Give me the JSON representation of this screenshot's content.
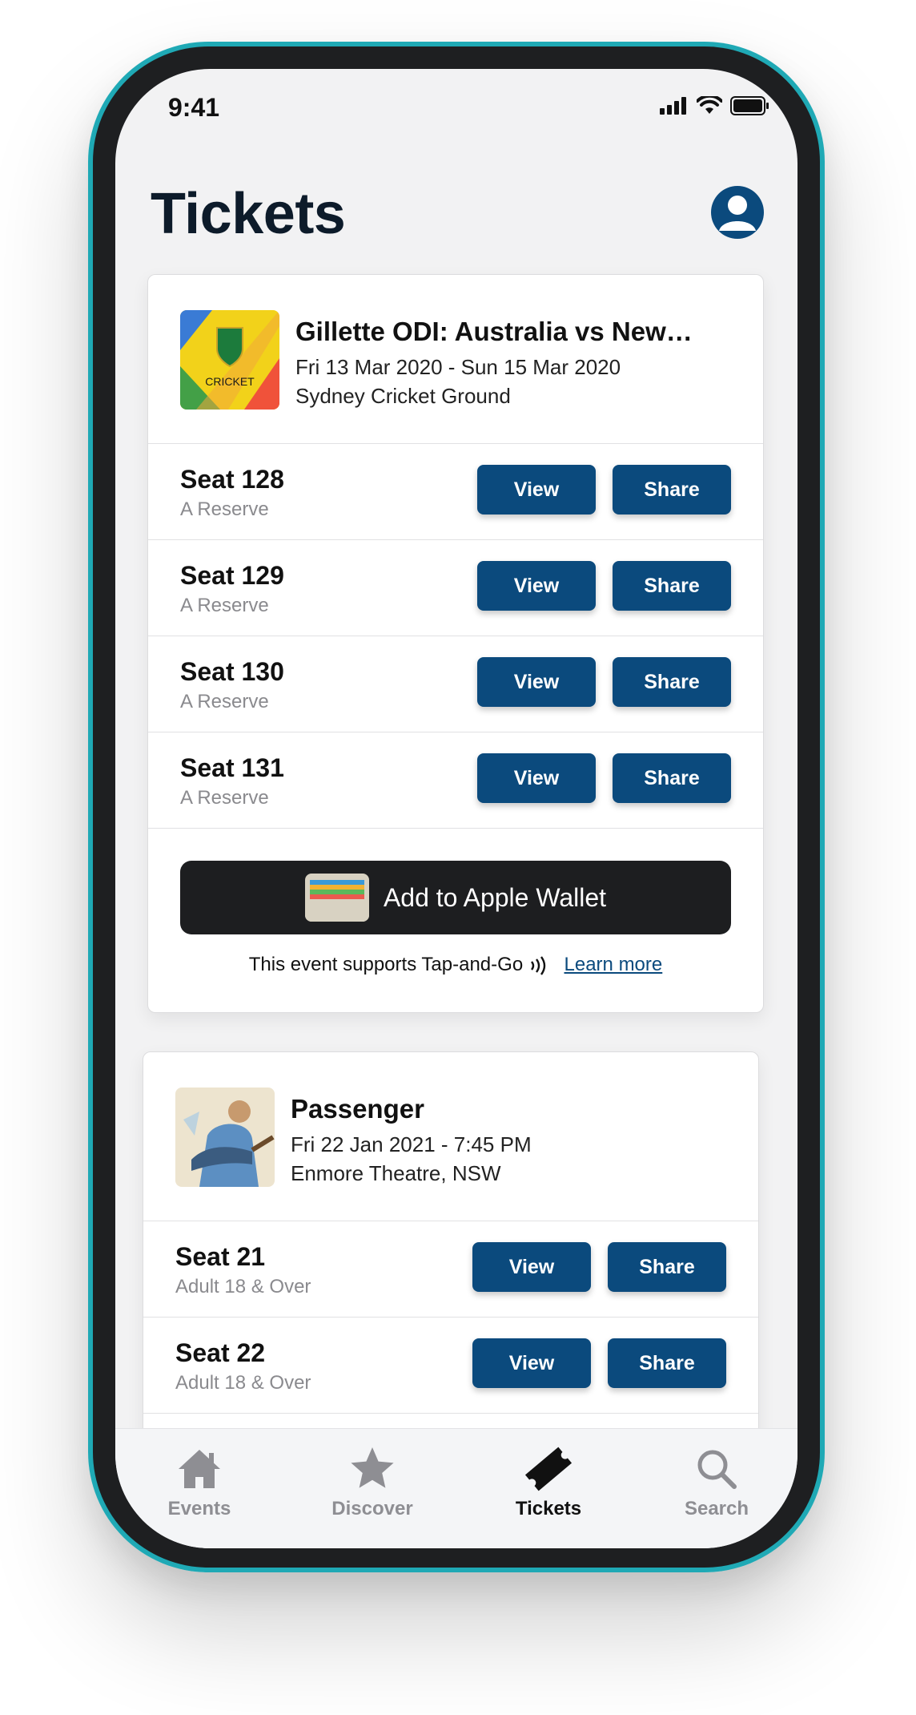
{
  "status_bar": {
    "time": "9:41"
  },
  "header": {
    "title": "Tickets"
  },
  "events": [
    {
      "title": "Gillette ODI: Australia vs New…",
      "date": "Fri 13 Mar 2020 - Sun 15 Mar 2020",
      "venue": "Sydney Cricket Ground",
      "logo_text": "CRICKET",
      "seats": [
        {
          "name": "Seat 128",
          "type": "A Reserve"
        },
        {
          "name": "Seat 129",
          "type": "A Reserve"
        },
        {
          "name": "Seat 130",
          "type": "A Reserve"
        },
        {
          "name": "Seat 131",
          "type": "A Reserve"
        }
      ],
      "wallet_label": "Add to Apple Wallet",
      "tap_text": "This event supports Tap-and-Go",
      "learn_more": "Learn more"
    },
    {
      "title": "Passenger",
      "date": "Fri 22 Jan 2021 - 7:45 PM",
      "venue": "Enmore Theatre, NSW",
      "seats": [
        {
          "name": "Seat 21",
          "type": "Adult 18 & Over"
        },
        {
          "name": "Seat 22",
          "type": "Adult 18 & Over"
        }
      ]
    }
  ],
  "buttons": {
    "view": "View",
    "share": "Share"
  },
  "tabs": [
    {
      "label": "Events",
      "icon": "home-icon"
    },
    {
      "label": "Discover",
      "icon": "star-icon"
    },
    {
      "label": "Tickets",
      "icon": "ticket-icon",
      "active": true
    },
    {
      "label": "Search",
      "icon": "search-icon"
    }
  ],
  "colors": {
    "accent": "#0b4a7d",
    "bezel": "#1e1f21",
    "frame": "#1fa9b5"
  }
}
